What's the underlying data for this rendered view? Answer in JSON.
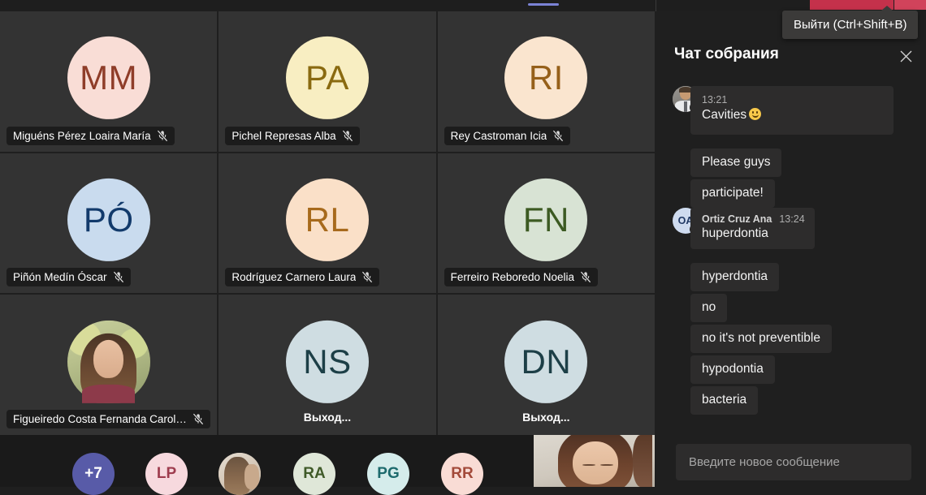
{
  "topbar": {
    "leave_button_label": "",
    "leave_menu_label": "",
    "accent_tab_color": "#7b83d6",
    "leave_color": "#c4314b",
    "leave_menu_color": "#d1435b"
  },
  "tooltip": {
    "text": "Выйти (Ctrl+Shift+B)"
  },
  "chat": {
    "title": "Чат собрания",
    "close_icon": "close-icon",
    "compose_placeholder": "Введите новое сообщение",
    "compose_value": "",
    "groups": [
      {
        "avatar_type": "photo",
        "presence": "available",
        "presence_color": "#6bb700",
        "author": "",
        "time": "13:21",
        "messages": [
          "Cavities"
        ],
        "has_emoji": true,
        "emoji": "slightly-smiling-face",
        "continuations": [
          "Please guys",
          "participate!"
        ]
      },
      {
        "avatar_type": "initials",
        "initials": "OA",
        "avatar_bg": "#cedbef",
        "avatar_fg": "#1f3864",
        "presence": "busy",
        "presence_color": "#c4314b",
        "author": "Ortiz Cruz Ana",
        "time": "13:24",
        "messages": [
          "huperdontia"
        ],
        "has_emoji": false,
        "continuations": [
          "hyperdontia",
          "no",
          "no it's not preventible",
          "hypodontia",
          "bacteria"
        ]
      }
    ]
  },
  "grid": {
    "tiles": [
      {
        "initials": "MM",
        "name": "Miguéns Pérez Loaira María",
        "avatar_bg": "#f9ddd6",
        "avatar_fg": "#8f3d29",
        "muted": true,
        "avatar_type": "initials",
        "status_label": ""
      },
      {
        "initials": "PA",
        "name": "Pichel Represas Alba",
        "avatar_bg": "#f8eec2",
        "avatar_fg": "#8a6a10",
        "muted": true,
        "avatar_type": "initials",
        "status_label": ""
      },
      {
        "initials": "RI",
        "name": "Rey Castroman Icia",
        "avatar_bg": "#fae5cf",
        "avatar_fg": "#96601a",
        "muted": true,
        "avatar_type": "initials",
        "status_label": ""
      },
      {
        "initials": "PÓ",
        "name": "Piñón Medín Óscar",
        "avatar_bg": "#c9dbee",
        "avatar_fg": "#123a6b",
        "muted": true,
        "avatar_type": "initials",
        "status_label": ""
      },
      {
        "initials": "RL",
        "name": "Rodríguez Carnero Laura",
        "avatar_bg": "#fae0c8",
        "avatar_fg": "#a76a1c",
        "muted": true,
        "avatar_type": "initials",
        "status_label": ""
      },
      {
        "initials": "FN",
        "name": "Ferreiro Reboredo Noelia",
        "avatar_bg": "#d8e3d4",
        "avatar_fg": "#3c5a22",
        "muted": true,
        "avatar_type": "initials",
        "status_label": ""
      },
      {
        "initials": "",
        "name": "Figueiredo Costa Fernanda Carolina",
        "avatar_bg": "#6d6a52",
        "avatar_fg": "#ffffff",
        "muted": true,
        "avatar_type": "photo",
        "status_label": ""
      },
      {
        "initials": "NS",
        "name": "",
        "avatar_bg": "#cfdde2",
        "avatar_fg": "#1d3f47",
        "muted": false,
        "avatar_type": "initials",
        "status_label": "Выход..."
      },
      {
        "initials": "DN",
        "name": "",
        "avatar_bg": "#cfdde2",
        "avatar_fg": "#1d3f47",
        "muted": false,
        "avatar_type": "initials",
        "status_label": "Выход..."
      }
    ]
  },
  "filmstrip": {
    "overflow_label": "+7",
    "overflow_bg": "#585ba8",
    "overflow_fg": "#ffffff",
    "items": [
      {
        "initials": "LP",
        "bg": "#f7d9de",
        "fg": "#9e3c4e",
        "type": "initials"
      },
      {
        "initials": "",
        "bg": "#cbbfae",
        "fg": "#ffffff",
        "type": "photo"
      },
      {
        "initials": "RA",
        "bg": "#dfe7d8",
        "fg": "#3f5a28",
        "type": "initials"
      },
      {
        "initials": "PG",
        "bg": "#d5eceb",
        "fg": "#1d6a6d",
        "type": "initials"
      },
      {
        "initials": "RR",
        "bg": "#f9dcd5",
        "fg": "#a34a3a",
        "type": "initials"
      }
    ]
  }
}
